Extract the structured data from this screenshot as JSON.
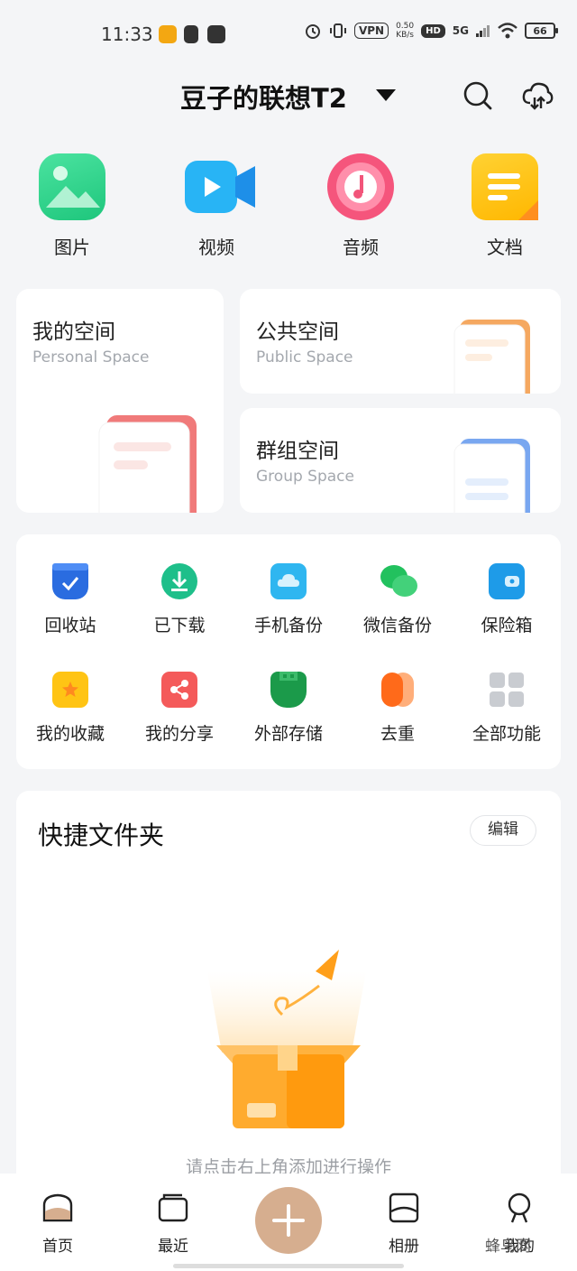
{
  "status_bar": {
    "time": "11:33",
    "vpn": "VPN",
    "net_speed_value": "0.50",
    "net_speed_unit": "KB/s",
    "hd": "HD",
    "network": "5G",
    "battery": "66"
  },
  "header": {
    "title": "豆子的联想T2",
    "search_icon": "search-icon",
    "cloud_icon": "cloud-sync-icon"
  },
  "categories": [
    {
      "label": "图片",
      "icon": "image-icon",
      "color": "#2bd48a"
    },
    {
      "label": "视频",
      "icon": "video-icon",
      "color": "#1aa0f0"
    },
    {
      "label": "音频",
      "icon": "audio-icon",
      "color": "#f2557a"
    },
    {
      "label": "文档",
      "icon": "document-icon",
      "color": "#ffbe1c"
    }
  ],
  "spaces": {
    "personal": {
      "title": "我的空间",
      "subtitle": "Personal Space",
      "accent": "#f07a7a"
    },
    "public": {
      "title": "公共空间",
      "subtitle": "Public Space",
      "accent": "#f5a860"
    },
    "group": {
      "title": "群组空间",
      "subtitle": "Group Space",
      "accent": "#79a7f0"
    }
  },
  "functions": [
    {
      "label": "回收站",
      "icon": "recycle-bin-icon",
      "color": "#2a6ce0"
    },
    {
      "label": "已下载",
      "icon": "download-icon",
      "color": "#1ebf8a"
    },
    {
      "label": "手机备份",
      "icon": "phone-backup-icon",
      "color": "#2fb6f0"
    },
    {
      "label": "微信备份",
      "icon": "wechat-backup-icon",
      "color": "#22c15e"
    },
    {
      "label": "保险箱",
      "icon": "safe-box-icon",
      "color": "#1e9be8"
    },
    {
      "label": "我的收藏",
      "icon": "favorites-icon",
      "color": "#ffc414"
    },
    {
      "label": "我的分享",
      "icon": "share-icon",
      "color": "#f45a5a"
    },
    {
      "label": "外部存储",
      "icon": "external-storage-icon",
      "color": "#1b9a4a"
    },
    {
      "label": "去重",
      "icon": "dedupe-icon",
      "color": "#ff6a1a"
    },
    {
      "label": "全部功能",
      "icon": "all-functions-icon",
      "color": "#c9ccd1"
    }
  ],
  "quick_folders": {
    "title": "快捷文件夹",
    "edit_label": "编辑",
    "empty_text": "请点击右上角添加进行操作"
  },
  "bottom_nav": [
    {
      "label": "首页",
      "icon": "home-icon",
      "active": true
    },
    {
      "label": "最近",
      "icon": "recent-icon",
      "active": false
    },
    {
      "label": "",
      "icon": "add-icon",
      "active": false
    },
    {
      "label": "相册",
      "icon": "album-icon",
      "active": false
    },
    {
      "label": "我的",
      "icon": "profile-icon",
      "active": false
    }
  ],
  "watermark": "蜂鸟网"
}
